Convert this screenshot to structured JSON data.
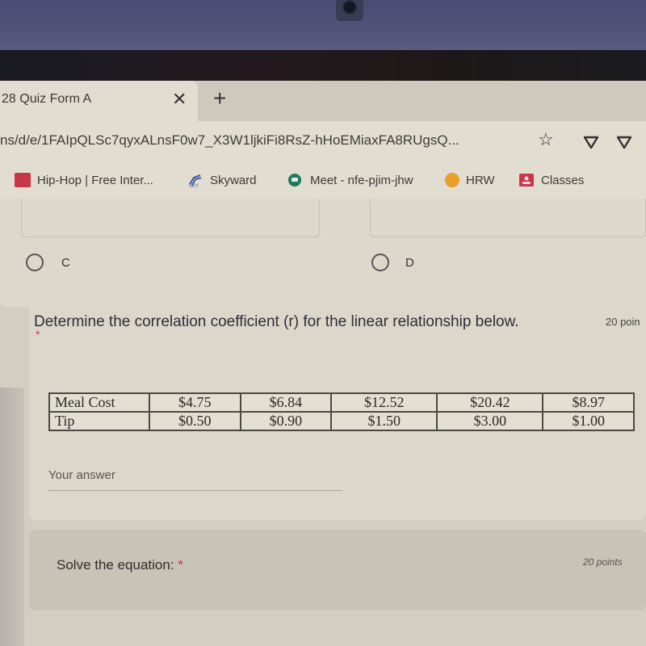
{
  "browser": {
    "tab": {
      "title": "28 Quiz Form A",
      "close_icon": "close-icon",
      "new_tab_icon": "plus-icon"
    },
    "address_bar": {
      "url": "ns/d/e/1FAIpQLSc7qyxALnsF0w7_X3W1ljkiFi8RsZ-hHoEMiaxFA8RUgsQ...",
      "icons": [
        "star-icon",
        "shield-extension-icon",
        "shield-extension-icon"
      ]
    },
    "bookmarks": [
      {
        "label": "Hip-Hop | Free Inter...",
        "icon": "hiphop-site-icon",
        "color": "#c8364a"
      },
      {
        "label": "Skyward",
        "icon": "skyward-icon",
        "color": "#3a5a9a"
      },
      {
        "label": "Meet - nfe-pjim-jhw",
        "icon": "google-meet-icon",
        "color": "#1e7a5a"
      },
      {
        "label": "HRW",
        "icon": "hrw-icon",
        "color": "#e9a02a"
      },
      {
        "label": "Classes",
        "icon": "classes-icon",
        "color": "#c8364a"
      }
    ]
  },
  "form": {
    "previous_question": {
      "options": [
        {
          "label": "C"
        },
        {
          "label": "D"
        }
      ]
    },
    "question": {
      "title": "Determine the correlation coefficient (r) for the linear relationship below.",
      "points": "20 poin",
      "required_mark": "*",
      "table": {
        "rows": [
          {
            "header": "Meal Cost",
            "values": [
              "$4.75",
              "$6.84",
              "$12.52",
              "$20.42",
              "$8.97"
            ]
          },
          {
            "header": "Tip",
            "values": [
              "$0.50",
              "$0.90",
              "$1.50",
              "$3.00",
              "$1.00"
            ]
          }
        ]
      },
      "answer_placeholder": "Your answer"
    },
    "next_question": {
      "title": "Solve the equation:",
      "required_mark": "*",
      "points": "20 points"
    }
  }
}
